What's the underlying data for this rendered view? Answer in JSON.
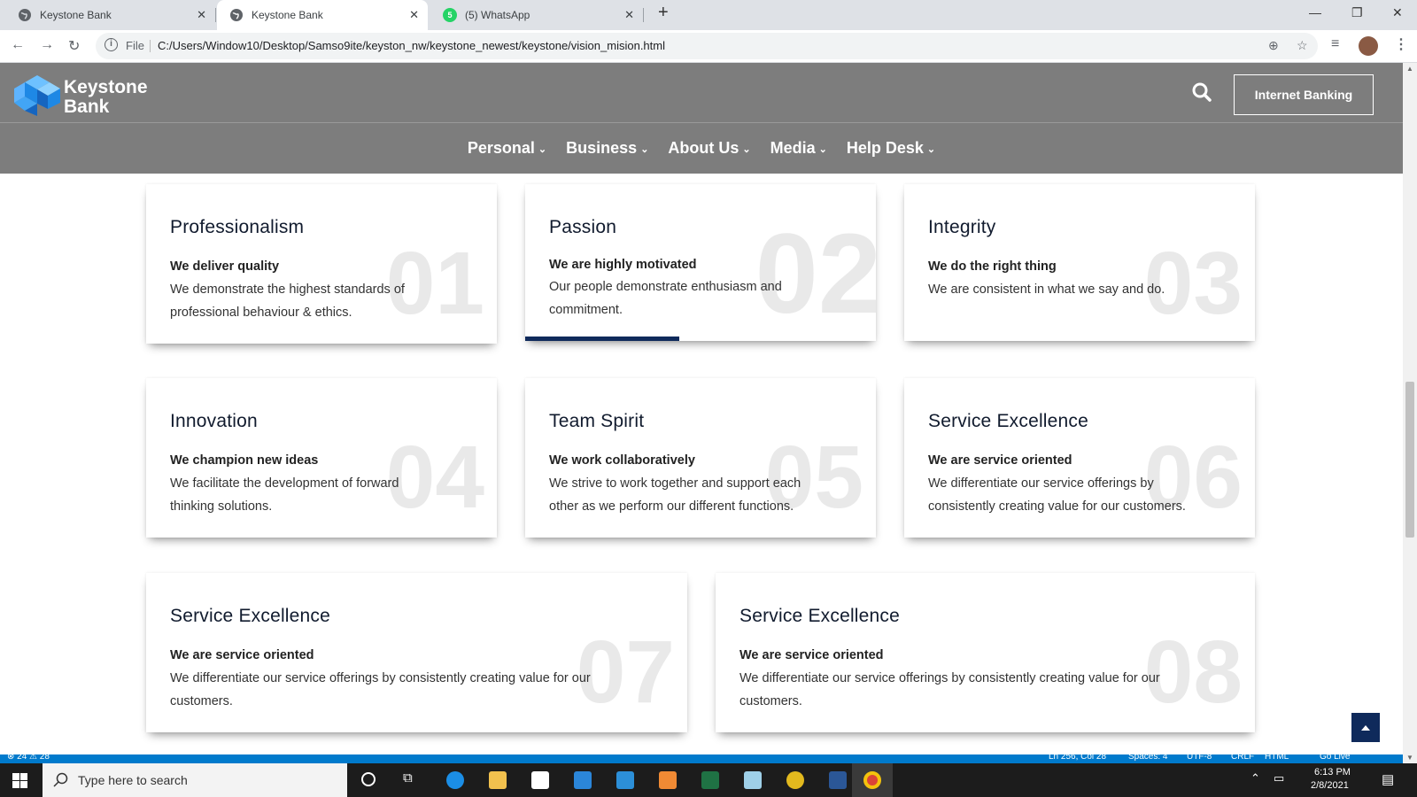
{
  "browser": {
    "tabs": [
      {
        "title": "Keystone Bank",
        "active": false
      },
      {
        "title": "Keystone Bank",
        "active": true
      },
      {
        "title": "(5) WhatsApp",
        "active": false
      }
    ],
    "address": {
      "scheme_label": "File",
      "url": "C:/Users/Window10/Desktop/Samso9ite/keyston_nw/keystone_newest/keystone/vision_mision.html"
    }
  },
  "site": {
    "logo_line1": "Keystone",
    "logo_line2": "Bank",
    "internet_banking_label": "Internet Banking",
    "nav": [
      "Personal",
      "Business",
      "About Us",
      "Media",
      "Help Desk"
    ]
  },
  "values": [
    {
      "number": "01",
      "title": "Professionalism",
      "subtitle": "We deliver quality",
      "description": "We demonstrate the highest standards of professional behaviour & ethics."
    },
    {
      "number": "02",
      "title": "Passion",
      "subtitle": "We are highly motivated",
      "description": "Our people demonstrate enthusiasm and commitment."
    },
    {
      "number": "03",
      "title": "Integrity",
      "subtitle": "We do the right thing",
      "description": "We are consistent in what we say and do."
    },
    {
      "number": "04",
      "title": "Innovation",
      "subtitle": "We champion new ideas",
      "description": "We facilitate the development of forward thinking solutions."
    },
    {
      "number": "05",
      "title": "Team Spirit",
      "subtitle": "We work collaboratively",
      "description": "We strive to work together and support each other as we perform our different functions."
    },
    {
      "number": "06",
      "title": "Service Excellence",
      "subtitle": "We are service oriented",
      "description": "We differentiate our service offerings by consistently creating value for our customers."
    },
    {
      "number": "07",
      "title": "Service Excellence",
      "subtitle": "We are service oriented",
      "description": "We differentiate our service offerings by consistently creating value for our customers."
    },
    {
      "number": "08",
      "title": "Service Excellence",
      "subtitle": "We are service oriented",
      "description": "We differentiate our service offerings by consistently creating value for our customers."
    }
  ],
  "editor_status": {
    "left": "⊗ 24 ⚠ 28",
    "position": "Ln 256, Col 28",
    "spaces": "Spaces: 4",
    "encoding": "UTF-8",
    "eol": "CRLF",
    "language": "HTML",
    "golive": "Go Live"
  },
  "taskbar": {
    "search_placeholder": "Type here to search",
    "time": "6:13 PM",
    "date": "2/8/2021"
  },
  "colors": {
    "header_gray": "#7d7d7d",
    "navy": "#0f2a5b",
    "logo_blue": "#1e88e5"
  }
}
